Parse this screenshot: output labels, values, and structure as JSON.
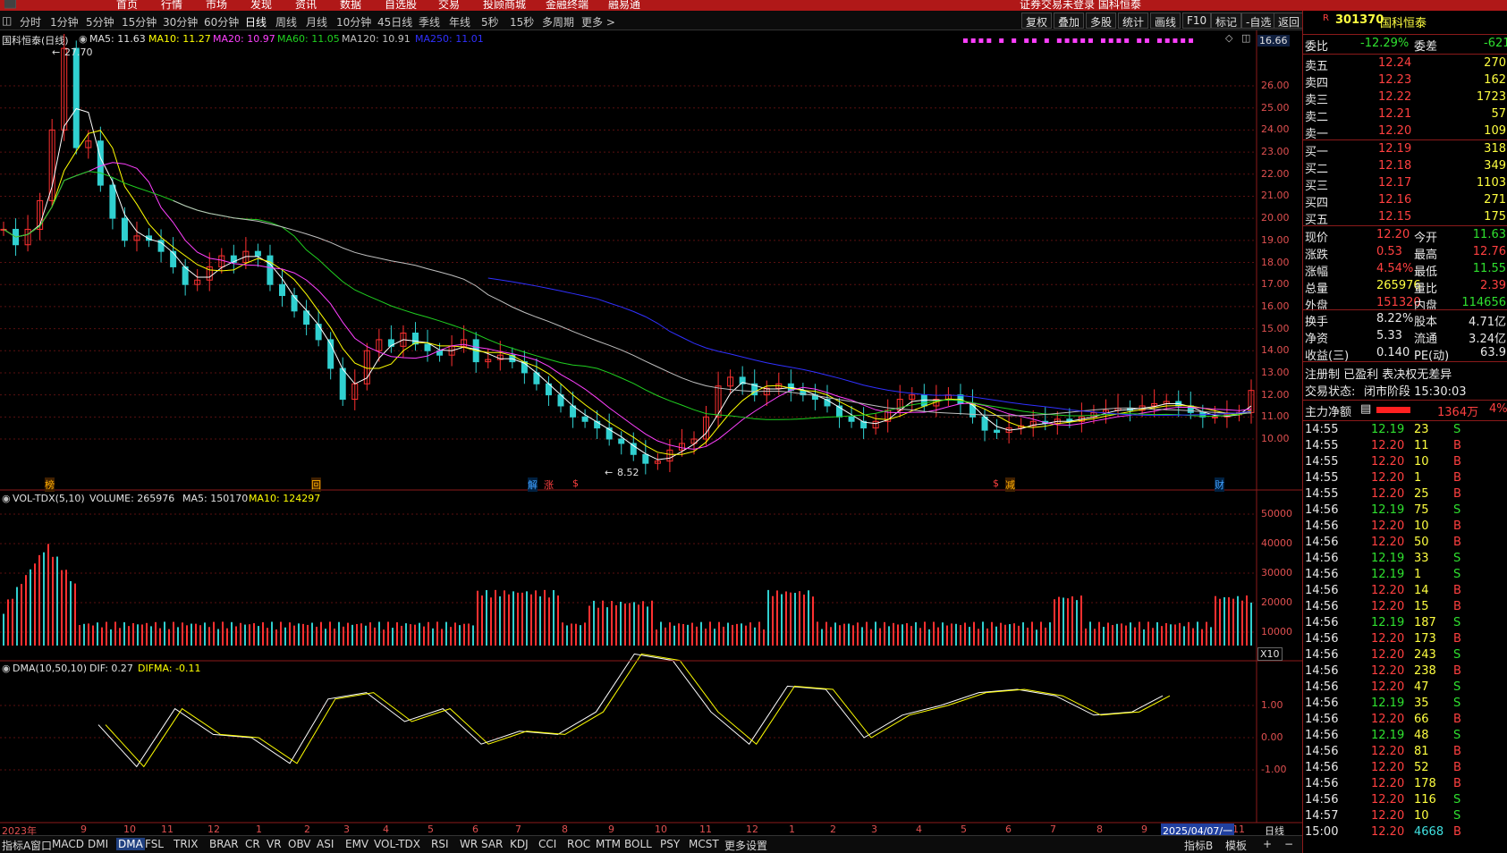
{
  "menubar": {
    "items": [
      "首页",
      "行情",
      "市场",
      "发现",
      "资讯",
      "数据",
      "自选股",
      "交易",
      "投顾商城",
      "金融终端",
      "融易通"
    ],
    "right_text": "证券交易未登录  国科恒泰"
  },
  "periods": [
    "分时",
    "1分钟",
    "5分钟",
    "15分钟",
    "30分钟",
    "60分钟",
    "日线",
    "周线",
    "月线",
    "10分钟",
    "45日线",
    "季线",
    "年线",
    "5秒",
    "15秒",
    "多周期",
    "更多 >"
  ],
  "active_period": "日线",
  "tools": [
    "复权",
    "叠加",
    "多股",
    "统计",
    "画线",
    "F10",
    "标记",
    "-自选",
    "返回"
  ],
  "main_legend": {
    "title": "国科恒泰(日线)",
    "ma5": "MA5: 11.63",
    "ma10": "MA10: 11.27",
    "ma20": "MA20: 10.97",
    "ma60": "MA60: 11.05",
    "ma120": "MA120: 10.91",
    "ma250": "MA250: 11.01"
  },
  "price_axis": [
    "26.00",
    "25.00",
    "24.00",
    "23.00",
    "22.00",
    "21.00",
    "20.00",
    "19.00",
    "18.00",
    "17.00",
    "16.00",
    "15.00",
    "14.00",
    "13.00",
    "12.00",
    "11.00",
    "10.00"
  ],
  "price_top_box": "16.66",
  "max_label": "27.70",
  "min_label": "8.52",
  "event_marks": [
    "榜",
    "回",
    "解",
    "涨",
    "$",
    "$",
    "减",
    "财"
  ],
  "vol_legend": {
    "title": "VOL-TDX(5,10)",
    "volume": "VOLUME: 265976",
    "ma5": "MA5: 150170",
    "ma10": "MA10: 124297"
  },
  "vol_axis": [
    "50000",
    "40000",
    "30000",
    "20000",
    "10000"
  ],
  "vol_unit": "X10",
  "dma_legend": {
    "title": "DMA(10,50,10)",
    "dif": "DIF: 0.27",
    "difma": "DIFMA: -0.11"
  },
  "dma_axis": [
    "1.00",
    "0.00",
    "-1.00"
  ],
  "date_axis": [
    "2023年",
    "9",
    "10",
    "11",
    "12",
    "1",
    "2",
    "3",
    "4",
    "5",
    "6",
    "7",
    "8",
    "9",
    "10",
    "11",
    "12",
    "1",
    "2",
    "3",
    "4",
    "5",
    "6",
    "7",
    "8",
    "9",
    "11"
  ],
  "date_highlight": "2025/04/07/一",
  "period_corner": "日线",
  "indicator_tabs": [
    "指标A",
    "窗口",
    "MACD",
    "DMI",
    "DMA",
    "FSL",
    "TRIX",
    "BRAR",
    "CR",
    "VR",
    "OBV",
    "ASI",
    "EMV",
    "VOL-TDX",
    "RSI",
    "WR",
    "SAR",
    "KDJ",
    "CCI",
    "ROC",
    "MTM",
    "BOLL",
    "PSY",
    "MCST",
    "更多",
    "设置"
  ],
  "active_indicator": "DMA",
  "bottom_right": [
    "指标B",
    "模板",
    "+",
    "−"
  ],
  "chart_data": {
    "type": "line",
    "title": "国科恒泰(日线)",
    "ylim": [
      8.0,
      27.7
    ],
    "series": [
      {
        "name": "MA5",
        "color": "#ffffff"
      },
      {
        "name": "MA10",
        "color": "#ffff00"
      },
      {
        "name": "MA20",
        "color": "#ff40ff"
      },
      {
        "name": "MA60",
        "color": "#20d020"
      },
      {
        "name": "MA120",
        "color": "#c0c0c0"
      },
      {
        "name": "MA250",
        "color": "#3030ff"
      }
    ],
    "close_points": [
      [
        0,
        19.5
      ],
      [
        1,
        18.8
      ],
      [
        2,
        19.5
      ],
      [
        3,
        20.8
      ],
      [
        4,
        24.0
      ],
      [
        5,
        27.7
      ],
      [
        6,
        23.2
      ],
      [
        7,
        23.5
      ],
      [
        8,
        21.5
      ],
      [
        9,
        20.0
      ],
      [
        10,
        19.0
      ],
      [
        11,
        19.2
      ],
      [
        12,
        19.0
      ],
      [
        13,
        18.5
      ],
      [
        14,
        17.8
      ],
      [
        15,
        17.0
      ],
      [
        16,
        17.2
      ],
      [
        17,
        17.8
      ],
      [
        18,
        18.3
      ],
      [
        19,
        18.0
      ],
      [
        20,
        18.5
      ],
      [
        21,
        18.3
      ],
      [
        22,
        17.0
      ],
      [
        23,
        16.5
      ],
      [
        24,
        15.8
      ],
      [
        25,
        15.2
      ],
      [
        26,
        14.5
      ],
      [
        27,
        13.2
      ],
      [
        28,
        11.8
      ],
      [
        29,
        12.5
      ],
      [
        30,
        14.0
      ],
      [
        31,
        14.5
      ],
      [
        32,
        14.2
      ],
      [
        33,
        14.8
      ],
      [
        34,
        14.3
      ],
      [
        35,
        14.0
      ],
      [
        36,
        13.8
      ],
      [
        37,
        14.2
      ],
      [
        38,
        14.5
      ],
      [
        39,
        13.5
      ],
      [
        40,
        13.6
      ],
      [
        41,
        13.8
      ],
      [
        42,
        13.5
      ],
      [
        43,
        13.0
      ],
      [
        44,
        12.5
      ],
      [
        45,
        12.0
      ],
      [
        46,
        11.5
      ],
      [
        47,
        11.0
      ],
      [
        48,
        10.8
      ],
      [
        49,
        10.5
      ],
      [
        50,
        10.0
      ],
      [
        51,
        9.8
      ],
      [
        52,
        9.3
      ],
      [
        53,
        8.9
      ],
      [
        54,
        9.0
      ],
      [
        55,
        9.5
      ],
      [
        56,
        9.8
      ],
      [
        57,
        10.0
      ],
      [
        58,
        11.0
      ],
      [
        59,
        12.4
      ],
      [
        60,
        12.8
      ],
      [
        61,
        12.5
      ],
      [
        62,
        12.0
      ],
      [
        63,
        12.3
      ],
      [
        64,
        12.5
      ],
      [
        65,
        12.2
      ],
      [
        66,
        12.0
      ],
      [
        67,
        11.8
      ],
      [
        68,
        11.5
      ],
      [
        69,
        11.0
      ],
      [
        70,
        10.8
      ],
      [
        71,
        10.5
      ],
      [
        72,
        10.8
      ],
      [
        73,
        11.3
      ],
      [
        74,
        11.8
      ],
      [
        75,
        12.0
      ],
      [
        76,
        11.5
      ],
      [
        77,
        11.8
      ],
      [
        78,
        12.0
      ],
      [
        79,
        11.6
      ],
      [
        80,
        11.0
      ],
      [
        81,
        10.4
      ],
      [
        82,
        10.3
      ],
      [
        83,
        10.5
      ],
      [
        84,
        10.6
      ],
      [
        85,
        10.8
      ],
      [
        86,
        10.7
      ],
      [
        87,
        10.9
      ],
      [
        88,
        10.8
      ],
      [
        89,
        11.0
      ],
      [
        90,
        11.2
      ],
      [
        91,
        11.3
      ],
      [
        92,
        11.4
      ],
      [
        93,
        11.3
      ],
      [
        94,
        11.5
      ],
      [
        95,
        11.6
      ],
      [
        96,
        11.7
      ],
      [
        97,
        11.5
      ],
      [
        98,
        11.2
      ],
      [
        99,
        11.0
      ],
      [
        100,
        11.0
      ],
      [
        101,
        11.1
      ],
      [
        102,
        11.2
      ],
      [
        103,
        12.2
      ]
    ],
    "dma_range": [
      -2.2,
      1.8
    ],
    "dif_points": [
      [
        0,
        -0.6
      ],
      [
        5,
        -1.9
      ],
      [
        10,
        -0.1
      ],
      [
        15,
        -0.9
      ],
      [
        20,
        -1.0
      ],
      [
        25,
        -1.8
      ],
      [
        30,
        0.2
      ],
      [
        35,
        0.4
      ],
      [
        40,
        -0.5
      ],
      [
        45,
        -0.1
      ],
      [
        50,
        -1.2
      ],
      [
        55,
        -0.8
      ],
      [
        60,
        -0.9
      ],
      [
        65,
        -0.2
      ],
      [
        70,
        1.6
      ],
      [
        75,
        1.4
      ],
      [
        80,
        -0.2
      ],
      [
        85,
        -1.2
      ],
      [
        90,
        0.6
      ],
      [
        95,
        0.5
      ],
      [
        100,
        -1.0
      ],
      [
        105,
        -0.3
      ],
      [
        110,
        0.0
      ],
      [
        115,
        0.4
      ],
      [
        120,
        0.5
      ],
      [
        125,
        0.3
      ],
      [
        130,
        -0.3
      ],
      [
        135,
        -0.2
      ],
      [
        139,
        0.3
      ]
    ]
  },
  "quote": {
    "code": "301370",
    "name": "国科恒泰",
    "weibi_label": "委比",
    "weibi": "-12.29%",
    "weicha_label": "委差",
    "weicha": "-621",
    "asks": [
      [
        "卖五",
        "12.24",
        "270"
      ],
      [
        "卖四",
        "12.23",
        "162"
      ],
      [
        "卖三",
        "12.22",
        "1723"
      ],
      [
        "卖二",
        "12.21",
        "57"
      ],
      [
        "卖一",
        "12.20",
        "109"
      ]
    ],
    "bids": [
      [
        "买一",
        "12.19",
        "318"
      ],
      [
        "买二",
        "12.18",
        "349"
      ],
      [
        "买三",
        "12.17",
        "1103"
      ],
      [
        "买四",
        "12.16",
        "271"
      ],
      [
        "买五",
        "12.15",
        "175"
      ]
    ],
    "stats": [
      [
        "现价",
        "12.20",
        "今开",
        "11.63"
      ],
      [
        "涨跌",
        "0.53",
        "最高",
        "12.76"
      ],
      [
        "涨幅",
        "4.54%",
        "最低",
        "11.55"
      ],
      [
        "总量",
        "265976",
        "量比",
        "2.39"
      ],
      [
        "外盘",
        "151320",
        "内盘",
        "114656"
      ]
    ],
    "fin": [
      [
        "换手",
        "8.22%",
        "股本",
        "4.71亿"
      ],
      [
        "净资",
        "5.33",
        "流通",
        "3.24亿"
      ],
      [
        "收益(三)",
        "0.140",
        "PE(动)",
        "63.9"
      ]
    ],
    "reg": "注册制 已盈利 表决权无差异",
    "status_label": "交易状态:",
    "status": "闭市阶段 15:30:03",
    "main_flow_label": "主力净额",
    "main_flow": "1364万",
    "main_flow_pct": "4%"
  },
  "ticks": [
    [
      "14:55",
      "12.19",
      "23",
      "S"
    ],
    [
      "14:55",
      "12.20",
      "11",
      "B"
    ],
    [
      "14:55",
      "12.20",
      "10",
      "B"
    ],
    [
      "14:55",
      "12.20",
      "1",
      "B"
    ],
    [
      "14:55",
      "12.20",
      "25",
      "B"
    ],
    [
      "14:56",
      "12.19",
      "75",
      "S"
    ],
    [
      "14:56",
      "12.20",
      "10",
      "B"
    ],
    [
      "14:56",
      "12.20",
      "50",
      "B"
    ],
    [
      "14:56",
      "12.19",
      "33",
      "S"
    ],
    [
      "14:56",
      "12.19",
      "1",
      "S"
    ],
    [
      "14:56",
      "12.20",
      "14",
      "B"
    ],
    [
      "14:56",
      "12.20",
      "15",
      "B"
    ],
    [
      "14:56",
      "12.19",
      "187",
      "S"
    ],
    [
      "14:56",
      "12.20",
      "173",
      "B"
    ],
    [
      "14:56",
      "12.20",
      "243",
      "S"
    ],
    [
      "14:56",
      "12.20",
      "238",
      "B"
    ],
    [
      "14:56",
      "12.20",
      "47",
      "S"
    ],
    [
      "14:56",
      "12.19",
      "35",
      "S"
    ],
    [
      "14:56",
      "12.20",
      "66",
      "B"
    ],
    [
      "14:56",
      "12.19",
      "48",
      "S"
    ],
    [
      "14:56",
      "12.20",
      "81",
      "B"
    ],
    [
      "14:56",
      "12.20",
      "52",
      "B"
    ],
    [
      "14:56",
      "12.20",
      "178",
      "B"
    ],
    [
      "14:56",
      "12.20",
      "116",
      "S"
    ],
    [
      "14:57",
      "12.20",
      "10",
      "S"
    ],
    [
      "15:00",
      "12.20",
      "4668",
      "B"
    ]
  ]
}
